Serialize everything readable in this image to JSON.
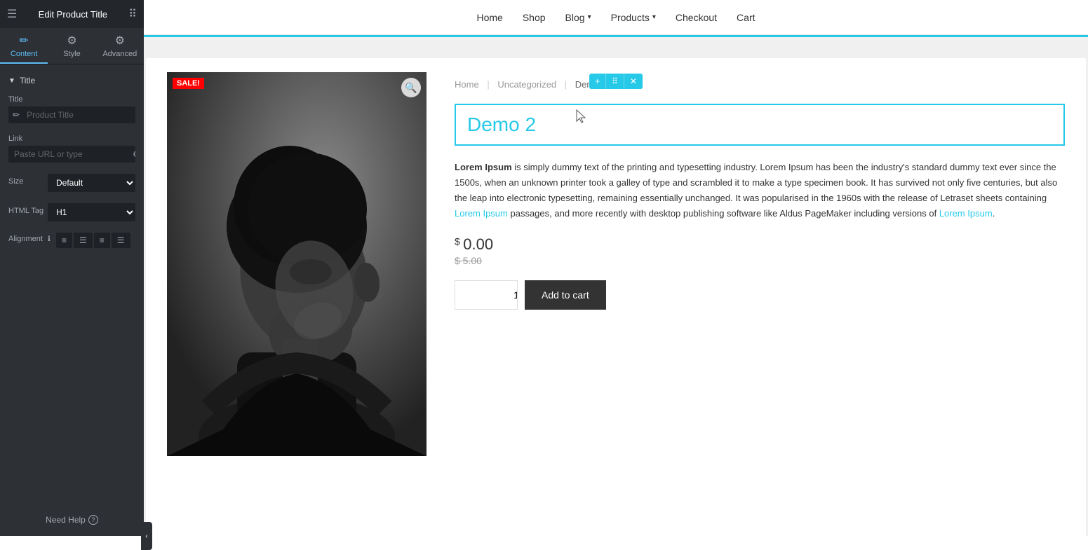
{
  "sidebar": {
    "header_title": "Edit Product Title",
    "tabs": [
      {
        "id": "content",
        "label": "Content",
        "icon": "✏️",
        "active": true
      },
      {
        "id": "style",
        "label": "Style",
        "icon": "⚙️",
        "active": false
      },
      {
        "id": "advanced",
        "label": "Advanced",
        "icon": "⚙️",
        "active": false
      }
    ],
    "section_title": "Title",
    "fields": {
      "title_label": "Title",
      "title_placeholder": "Product Title",
      "link_label": "Link",
      "link_placeholder": "Paste URL or type",
      "size_label": "Size",
      "size_default": "Default",
      "html_tag_label": "HTML Tag",
      "html_tag_default": "H1",
      "alignment_label": "Alignment"
    },
    "help_text": "Need Help"
  },
  "nav": {
    "items": [
      {
        "label": "Home",
        "has_dropdown": false
      },
      {
        "label": "Shop",
        "has_dropdown": false
      },
      {
        "label": "Blog",
        "has_dropdown": true
      },
      {
        "label": "Products",
        "has_dropdown": true
      },
      {
        "label": "Checkout",
        "has_dropdown": false
      },
      {
        "label": "Cart",
        "has_dropdown": false
      }
    ]
  },
  "product": {
    "sale_badge": "SALE!",
    "breadcrumb": {
      "home": "Home",
      "category": "Uncategorized",
      "current": "Demo 2"
    },
    "title": "Demo 2",
    "description_html": "<strong>Lorem Ipsum</strong> is simply dummy text of the printing and typesetting industry. Lorem Ipsum has been the industry's standard dummy text ever since the 1500s, when an unknown printer took a galley of type and scrambled it to make a type specimen book. It has survived not only five centuries, but also the leap into electronic typesetting, remaining essentially unchanged. It was popularised in the 1960s with the release of Letraset sheets containing Lorem Ipsum passages, and more recently with desktop publishing software like Aldus PageMaker including versions of Lorem Ipsum.",
    "price_current": "0.00",
    "price_dollar_sign": "$",
    "price_old": "$ 5.00",
    "quantity": "1",
    "add_to_cart_label": "Add to cart"
  },
  "widget_toolbar": {
    "plus": "+",
    "move": "⠿",
    "close": "✕"
  },
  "colors": {
    "accent": "#26c9e8",
    "sidebar_bg": "#2d3035",
    "dark": "#23262b"
  }
}
